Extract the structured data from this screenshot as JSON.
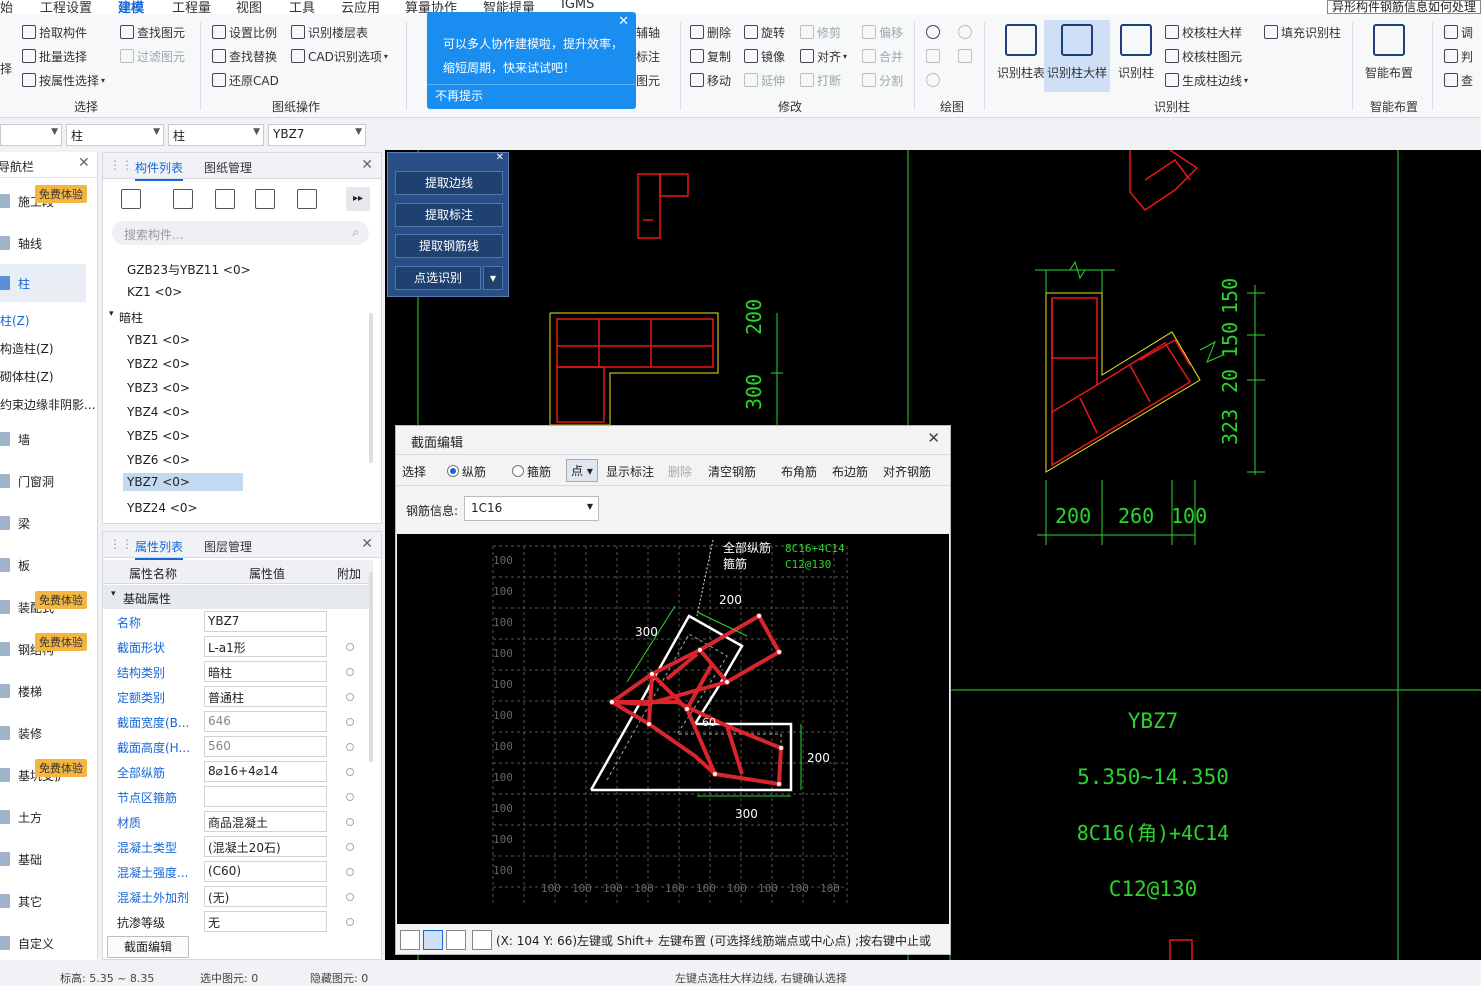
{
  "menu": [
    "始",
    "工程设置",
    "建模",
    "工程量",
    "视图",
    "工具",
    "云应用",
    "算量协作",
    "智能提量",
    "IGMS"
  ],
  "help_text": "异形构件钢筋信息如何处理",
  "ribbon": {
    "select": {
      "pick": "拾取构件",
      "batch": "批量选择",
      "by_attr": "按属性选择",
      "group": "选择",
      "left_partial": "择"
    },
    "find": {
      "find": "查找图元",
      "filter": "过滤图元"
    },
    "drawing": {
      "scale": "设置比例",
      "find_replace": "查找替换",
      "restore": "还原CAD",
      "floor": "识别楼层表",
      "cad_opt": "CAD识别选项",
      "group": "图纸操作"
    },
    "partial": {
      "a": "辅轴",
      "b": "标注",
      "c": "图元"
    },
    "modify": {
      "delete": "删除",
      "rotate": "旋转",
      "trim": "修剪",
      "offset": "偏移",
      "copy": "复制",
      "mirror": "镜像",
      "align": "对齐",
      "merge": "合并",
      "move": "移动",
      "extend": "延伸",
      "break": "打断",
      "split": "分割",
      "group": "修改"
    },
    "draw": {
      "group": "绘图"
    },
    "recognize": {
      "col_table": "识别柱表",
      "col_detail": "识别柱大样",
      "col": "识别柱",
      "check_detail": "校核柱大样",
      "check_elem": "校核柱图元",
      "gen_edge": "生成柱边线",
      "fill": "填充识别柱",
      "group": "识别柱"
    },
    "smart": {
      "label": "智能布置",
      "group": "智能布置"
    },
    "right": {
      "a": "调",
      "b": "判",
      "c": "查"
    }
  },
  "tooltip": {
    "text": "可以多人协作建模啦，提升效率，缩短周期，快来试试吧！",
    "dismiss": "不再提示"
  },
  "filters": {
    "f1": "柱",
    "f2": "柱",
    "f3": "YBZ7"
  },
  "nav": {
    "title": "导航栏",
    "items": [
      "施工段",
      "轴线",
      "柱",
      "柱(Z)",
      "构造柱(Z)",
      "砌体柱(Z)",
      "约束边缘非阴影...",
      "墙",
      "门窗洞",
      "梁",
      "板",
      "装配式",
      "钢结构",
      "楼梯",
      "装修",
      "基坑支护",
      "土方",
      "基础",
      "其它",
      "自定义"
    ],
    "badge": "免费体验"
  },
  "comp_panel": {
    "tabs": [
      "构件列表",
      "图纸管理"
    ],
    "search_placeholder": "搜索构件...",
    "items": [
      "GZB23与YBZ11 <0>",
      "KZ1 <0>",
      "暗柱",
      "YBZ1 <0>",
      "YBZ2 <0>",
      "YBZ3 <0>",
      "YBZ4 <0>",
      "YBZ5 <0>",
      "YBZ6 <0>",
      "YBZ7 <0>",
      "YBZ24 <0>"
    ]
  },
  "prop_panel": {
    "tabs": [
      "属性列表",
      "图层管理"
    ],
    "headers": [
      "属性名称",
      "属性值",
      "附加"
    ],
    "section": "基础属性",
    "rows": [
      {
        "name": "名称",
        "value": "YBZ7"
      },
      {
        "name": "截面形状",
        "value": "L-a1形"
      },
      {
        "name": "结构类别",
        "value": "暗柱"
      },
      {
        "name": "定额类别",
        "value": "普通柱"
      },
      {
        "name": "截面宽度(B...",
        "value": "646"
      },
      {
        "name": "截面高度(H...",
        "value": "560"
      },
      {
        "name": "全部纵筋",
        "value": "8⌀16+4⌀14"
      },
      {
        "name": "节点区箍筋",
        "value": ""
      },
      {
        "name": "材质",
        "value": "商品混凝土"
      },
      {
        "name": "混凝土类型",
        "value": "(混凝土20石)"
      },
      {
        "name": "混凝土强度...",
        "value": "(C60)"
      },
      {
        "name": "混凝土外加剂",
        "value": "(无)"
      },
      {
        "name": "抗渗等级",
        "value": "无"
      }
    ],
    "footer_btn": "截面编辑"
  },
  "extract": {
    "btn1": "提取边线",
    "btn2": "提取标注",
    "btn3": "提取钢筋线",
    "btn4": "点选识别"
  },
  "cad": {
    "dims_right": [
      "150",
      "150",
      "20",
      "323"
    ],
    "dims_bottom": [
      "200",
      "260",
      "100"
    ],
    "dim_mid": "200",
    "dim_mid2": "300",
    "table": {
      "name": "YBZ7",
      "elev": "5.350~14.350",
      "rebar": "8C16(角)+4C14",
      "stirrup": "C12@130"
    }
  },
  "dialog": {
    "title": "截面编辑",
    "toolbar": {
      "select": "选择",
      "long": "纵筋",
      "stirrup": "箍筋",
      "point": "点",
      "show_dim": "显示标注",
      "delete": "删除",
      "clear": "清空钢筋",
      "corner": "布角筋",
      "edge": "布边筋",
      "align": "对齐钢筋"
    },
    "rebar_label": "钢筋信息:",
    "rebar_value": "1C16",
    "annot": {
      "l1": "全部纵筋",
      "l2": "箍筋",
      "v1": "8C16+4C14",
      "v2": "C12@130"
    },
    "dims": {
      "top": "200",
      "left": "300",
      "right": "200",
      "bottom": "300",
      "mid": "60"
    },
    "grid_label": "100",
    "status": "(X: 104 Y: 66)左键或 Shift+ 左键布置 (可选择线筋端点或中心点) ;按右键中止或"
  },
  "statusbar": {
    "a": "标高: 5.35 ~ 8.35",
    "b": "选中图元: 0",
    "c": "隐藏图元: 0",
    "d": "左键点选柱大样边线, 右键确认选择"
  }
}
